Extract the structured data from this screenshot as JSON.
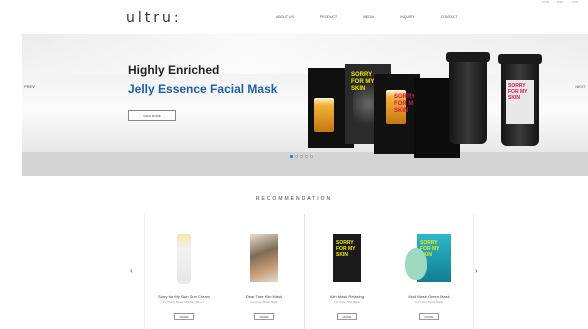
{
  "header": {
    "logo": "ultru:",
    "lang": [
      "KOR",
      "ENG",
      "CHN"
    ],
    "nav": [
      "ABOUT US",
      "PRODUCT",
      "MEDIA",
      "INQUIRY",
      "CONTACT"
    ]
  },
  "hero": {
    "title_line1": "Highly Enriched",
    "title_line2": "Jelly Essence Facial Mask",
    "button": "VIEW MORE",
    "prev": "PREV",
    "next": "NEXT",
    "slides_total": 5,
    "slide_active": 1,
    "pack_text": "SORRY\nFOR MY\nSKIN",
    "cup_text": "SORRY\nFOR MY\nSKIN"
  },
  "recommendation": {
    "title": "RECOMMENDATION",
    "prev_arrow": "‹",
    "next_arrow": "›",
    "products": [
      {
        "name": "Sorry for My Skin Sun Cream",
        "sub": "For Face Body SPF50+ PA+++",
        "button": "MORE"
      },
      {
        "name": "Dear Tree Kiln Mask",
        "sub": "For Face Moist Mask",
        "button": "MORE"
      },
      {
        "name": "Kiln Mask Relaxing",
        "sub": "For Face Soft Mask",
        "button": "MORE"
      },
      {
        "name": "Mud Mask Green Mask",
        "sub": "For Face Moist Mask",
        "button": "MORE"
      }
    ]
  },
  "colors": {
    "brand_blue": "#1f5ea8",
    "accent_pink": "#d3154f",
    "pack_yellow": "#f4e60a"
  }
}
